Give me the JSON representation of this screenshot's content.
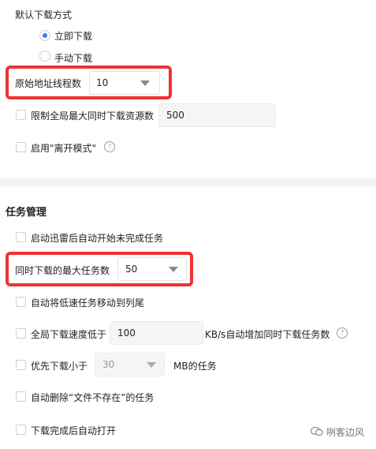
{
  "section1": {
    "heading": "默认下载方式",
    "radio_immediate": "立即下载",
    "radio_manual": "手动下载",
    "origin_threads_label": "原始地址线程数",
    "origin_threads_value": "10",
    "limit_global_label": "限制全局最大同时下载资源数",
    "limit_global_value": "500",
    "offline_label": "启用\"离开模式\"",
    "help_glyph": "?"
  },
  "section2": {
    "title": "任务管理",
    "auto_start_label": "启动迅雷后自动开始未完成任务",
    "max_tasks_label": "同时下载的最大任务数",
    "max_tasks_value": "50",
    "move_slow_label": "自动将低速任务移动到列尾",
    "speed_prefix": "全局下载速度低于",
    "speed_value": "100",
    "speed_suffix": "KB/s自动增加同时下载任务数",
    "priority_prefix": "优先下载小于",
    "priority_value": "30",
    "priority_suffix": "MB的任务",
    "auto_delete_label": "自动删除“文件不存在”的任务",
    "open_after_label": "下载完成后自动打开",
    "help_glyph": "?"
  },
  "watermark": "咧客边风"
}
